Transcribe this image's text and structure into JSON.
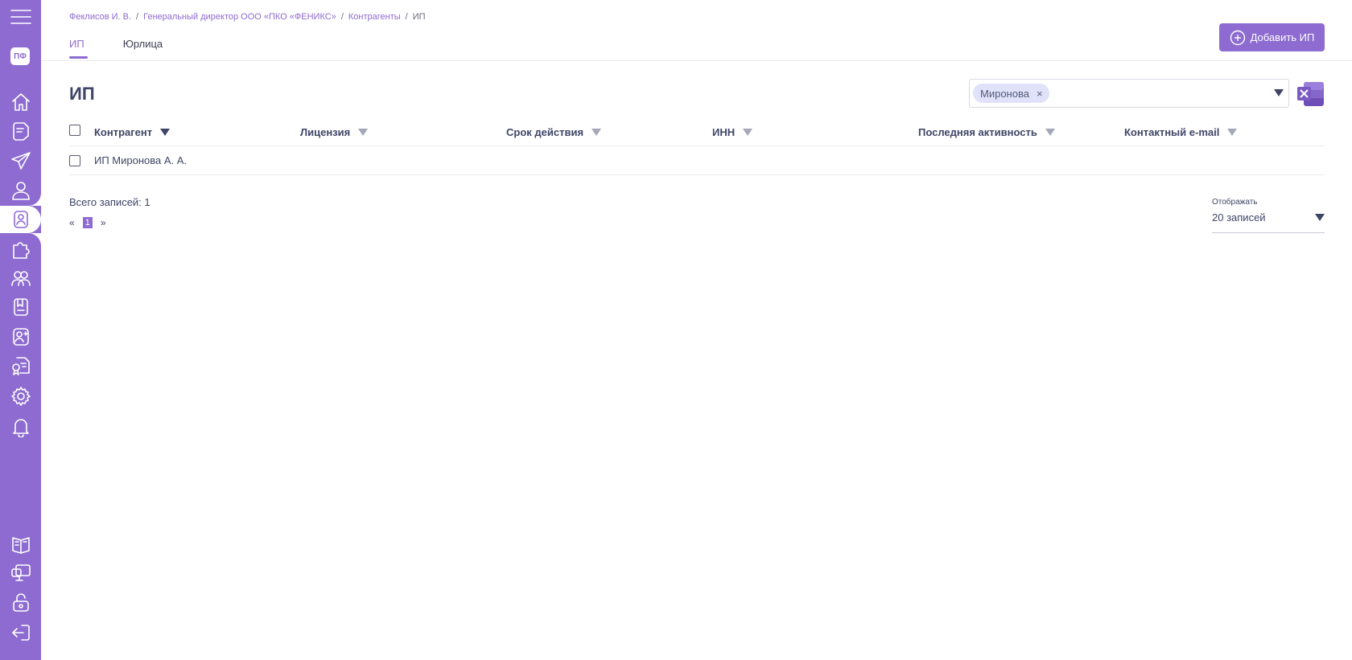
{
  "sidebar": {
    "logo": "ПФ",
    "accent_color": "#8d6bd0",
    "icons": [
      "menu-icon",
      "home-icon",
      "document-icon",
      "send-icon",
      "user-icon",
      "contractor-icon",
      "puzzle-icon",
      "users-group-icon",
      "book-card-icon",
      "add-user-icon",
      "certificate-icon",
      "gear-icon",
      "bell-icon",
      "open-book-icon",
      "monitor-icon",
      "lock-icon",
      "logout-icon"
    ]
  },
  "breadcrumb": {
    "items": [
      "Феклисов И. В.",
      "Генеральный директор ООО «ПКО «ФЕНИКС»",
      "Контрагенты"
    ],
    "current": "ИП",
    "separator": "/"
  },
  "tabs": [
    {
      "label": "ИП",
      "active": true
    },
    {
      "label": "Юрлица",
      "active": false
    }
  ],
  "add_button": {
    "label": "Добавить ИП"
  },
  "page_title": "ИП",
  "filter": {
    "chip": "Миронова",
    "chip_remove": "×"
  },
  "table": {
    "columns": [
      "Контрагент",
      "Лицензия",
      "Срок действия",
      "ИНН",
      "Последняя активность",
      "Контактный e-mail"
    ],
    "rows": [
      {
        "name": "ИП Миронова А. А.",
        "license": "",
        "valid_until": "",
        "inn": "",
        "last_activity": "",
        "email": ""
      }
    ]
  },
  "footer": {
    "total": "Всего записей: 1",
    "pager_prev": "«",
    "pager_current": "1",
    "pager_next": "»",
    "per_page_label": "Отображать",
    "per_page_value": "20 записей"
  }
}
